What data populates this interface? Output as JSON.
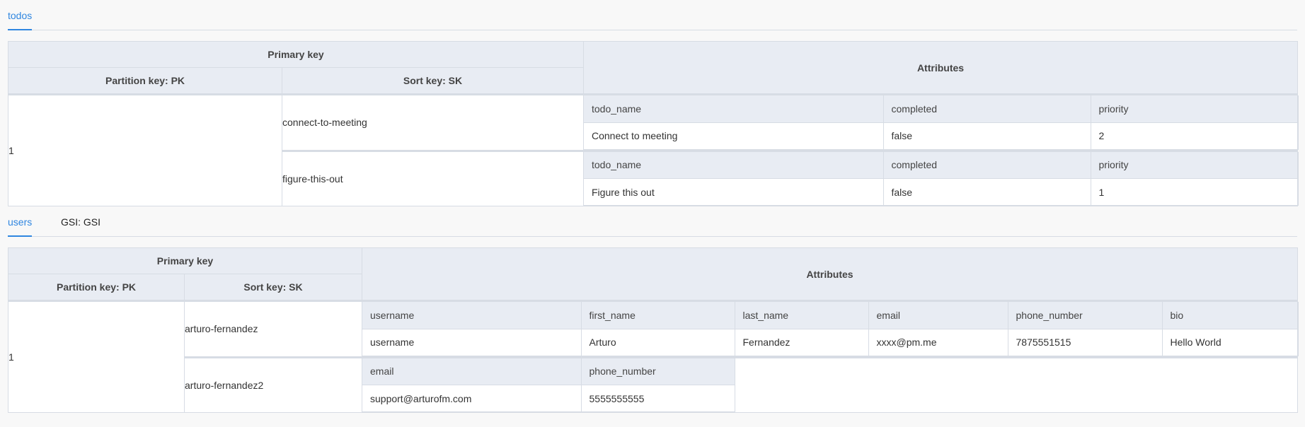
{
  "todos_tabs": [
    {
      "label": "todos",
      "active": true
    }
  ],
  "todos": {
    "header": {
      "primary_key": "Primary key",
      "partition_key": "Partition key: PK",
      "sort_key": "Sort key: SK",
      "attributes": "Attributes"
    },
    "partition_value": "1",
    "items": [
      {
        "sort_key": "connect-to-meeting",
        "attr_names": [
          "todo_name",
          "completed",
          "priority"
        ],
        "attr_values": [
          "Connect to meeting",
          "false",
          "2"
        ]
      },
      {
        "sort_key": "figure-this-out",
        "attr_names": [
          "todo_name",
          "completed",
          "priority"
        ],
        "attr_values": [
          "Figure this out",
          "false",
          "1"
        ]
      }
    ]
  },
  "users_tabs": [
    {
      "label": "users",
      "active": true
    },
    {
      "label": "GSI: GSI",
      "active": false
    }
  ],
  "users": {
    "header": {
      "primary_key": "Primary key",
      "partition_key": "Partition key: PK",
      "sort_key": "Sort key: SK",
      "attributes": "Attributes"
    },
    "partition_value": "1",
    "items": [
      {
        "sort_key": "arturo-fernandez",
        "attr_names": [
          "username",
          "first_name",
          "last_name",
          "email",
          "phone_number",
          "bio"
        ],
        "attr_values": [
          "username",
          "Arturo",
          "Fernandez",
          "xxxx@pm.me",
          "7875551515",
          "Hello World"
        ]
      },
      {
        "sort_key": "arturo-fernandez2",
        "attr_names": [
          "email",
          "phone_number"
        ],
        "attr_values": [
          "support@arturofm.com",
          "5555555555"
        ]
      }
    ]
  },
  "colors": {
    "accent": "#2f86e0",
    "header_bg": "#e8ecf3",
    "border": "#d7dce4",
    "page_bg": "#f8f8f8"
  }
}
